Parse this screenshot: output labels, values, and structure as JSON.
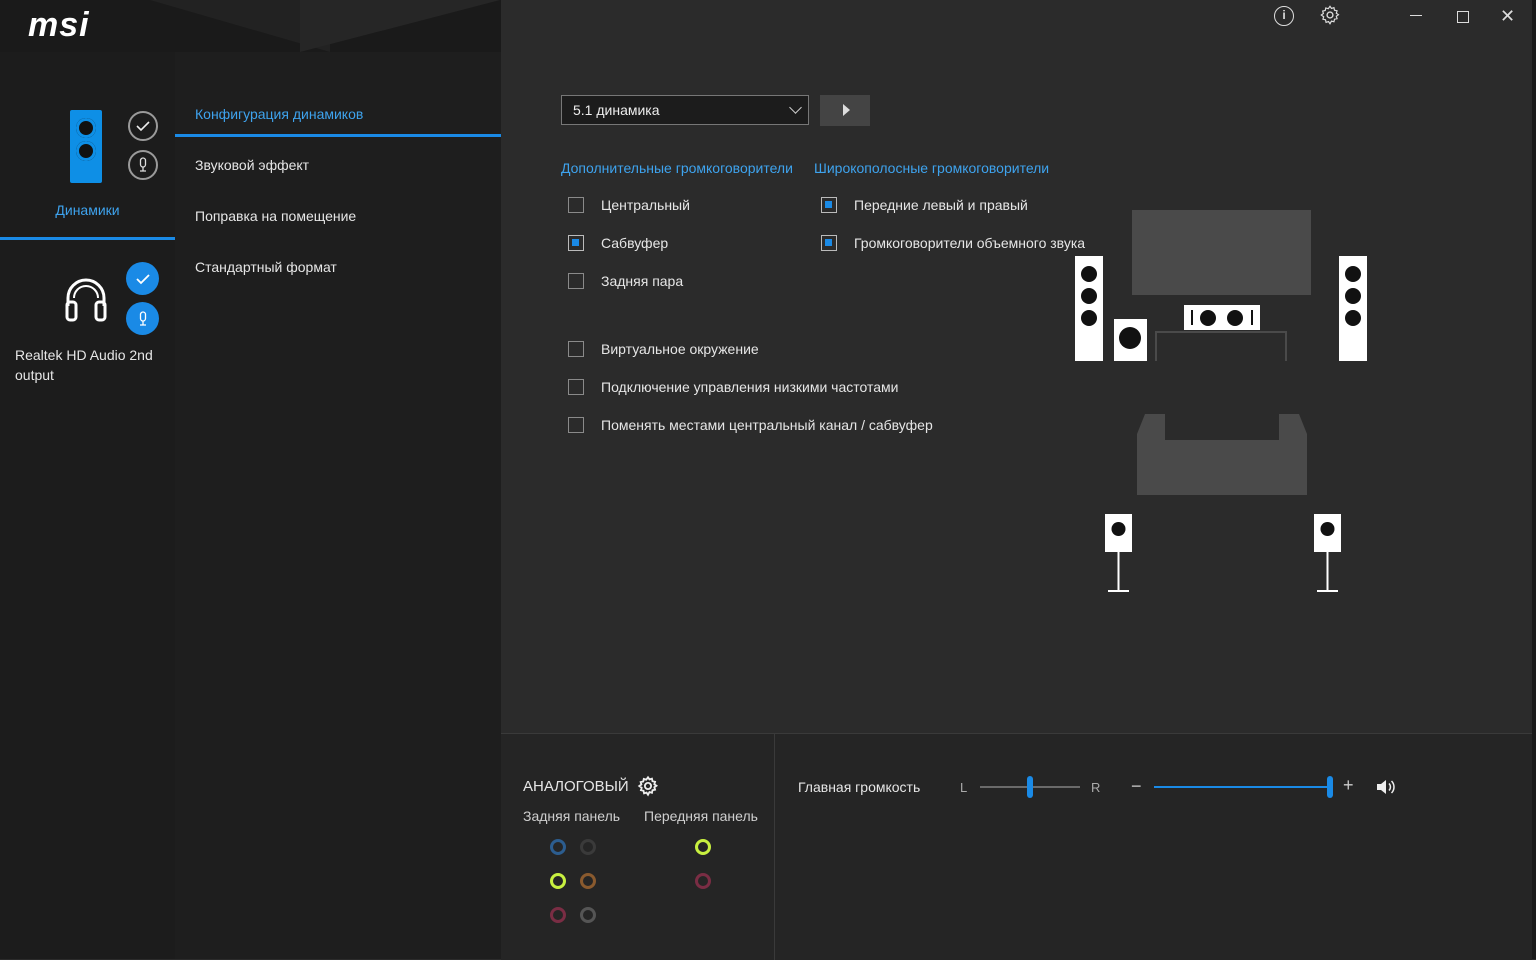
{
  "logo": "msi",
  "titlebar": {
    "info_icon": "info-icon",
    "settings_icon": "gear-icon"
  },
  "devices": [
    {
      "label": "Динамики"
    },
    {
      "label": "Realtek HD Audio 2nd output"
    }
  ],
  "nav": [
    {
      "label": "Конфигурация динамиков"
    },
    {
      "label": "Звуковой эффект"
    },
    {
      "label": "Поправка на помещение"
    },
    {
      "label": "Стандартный формат"
    }
  ],
  "config": {
    "select_value": "5.1 динамика",
    "section_optional": "Дополнительные громкоговорители",
    "section_fullrange": "Широкополосные громкоговорители",
    "optional": [
      {
        "label": "Центральный",
        "checked": false
      },
      {
        "label": "Сабвуфер",
        "checked": true
      },
      {
        "label": "Задняя пара",
        "checked": false
      }
    ],
    "fullrange": [
      {
        "label": "Передние левый и правый",
        "checked": true
      },
      {
        "label": "Громкоговорители объемного звука",
        "checked": true
      }
    ],
    "options": [
      {
        "label": "Виртуальное окружение",
        "checked": false
      },
      {
        "label": "Подключение управления низкими частотами",
        "checked": false
      },
      {
        "label": "Поменять местами центральный канал / сабвуфер",
        "checked": false
      }
    ]
  },
  "bottom": {
    "analog_title": "АНАЛОГОВЫЙ",
    "rear_panel": "Задняя панель",
    "front_panel": "Передняя панель",
    "volume_label": "Главная громкость",
    "balance_left": "L",
    "balance_right": "R",
    "minus": "−",
    "plus": "+",
    "balance_value": 0.5,
    "volume_value": 1.0
  },
  "colors": {
    "accent": "#1a8ae6",
    "accent_text": "#3ea3ee"
  }
}
